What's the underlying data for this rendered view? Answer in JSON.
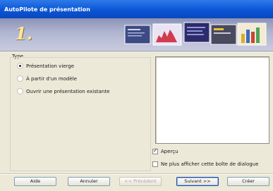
{
  "window": {
    "title": "AutoPilote de présentation"
  },
  "banner": {
    "step_number": "1."
  },
  "type_group": {
    "label": "Type",
    "options": [
      {
        "label": "Présentation vierge",
        "selected": true
      },
      {
        "label": "À partir d'un modèle",
        "selected": false
      },
      {
        "label": "Ouvrir une présentation existante",
        "selected": false
      }
    ]
  },
  "preview": {
    "checkbox_label": "Aperçu",
    "checked": true
  },
  "dont_show": {
    "checkbox_label": "Ne plus afficher cette boîte de dialogue",
    "checked": false
  },
  "buttons": {
    "help": "Aide",
    "cancel": "Annuler",
    "back": "<< Précédent",
    "next": "Suivant >>",
    "create": "Créer"
  },
  "colors": {
    "title_bar": "#0a55d6",
    "banner": "#aeb3cf",
    "dialog_bg": "#ece9d8"
  }
}
